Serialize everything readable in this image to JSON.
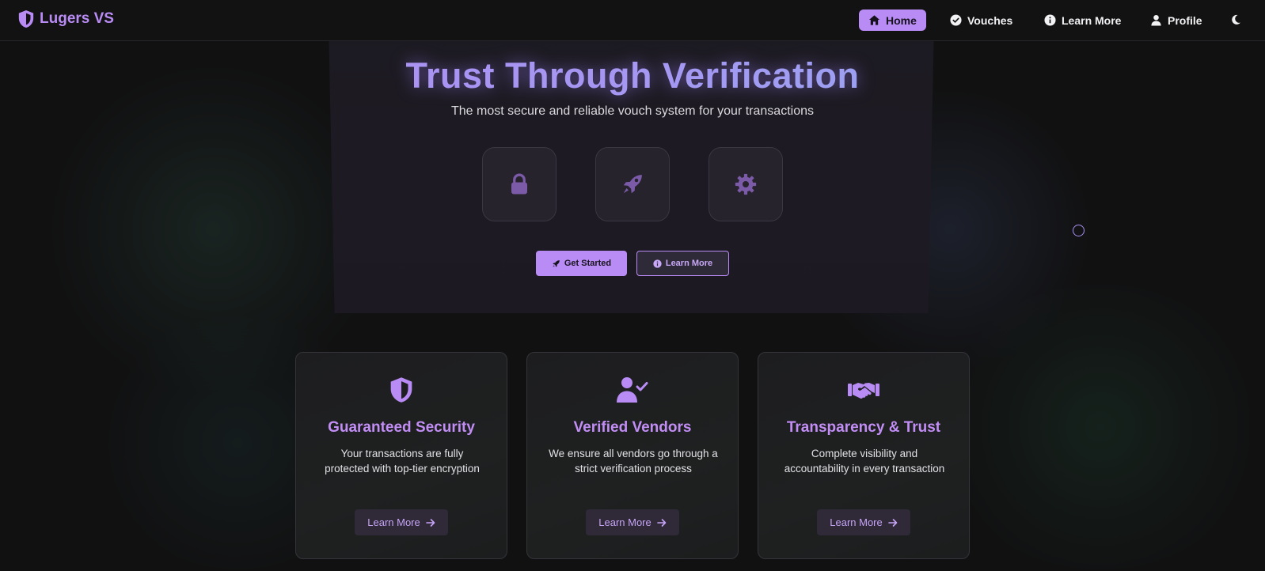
{
  "brand": {
    "name": "Lugers VS",
    "icon": "shield-icon",
    "accent": "#b98cf5"
  },
  "nav": {
    "items": [
      {
        "label": "Home",
        "icon": "home-icon",
        "active": true
      },
      {
        "label": "Vouches",
        "icon": "check-circle-icon"
      },
      {
        "label": "Learn More",
        "icon": "info-circle-icon"
      },
      {
        "label": "Profile",
        "icon": "user-icon"
      }
    ],
    "theme_toggle_icon": "moon-icon"
  },
  "hero": {
    "title": "Trust Through Verification",
    "subtitle": "The most secure and reliable vouch system for your transactions",
    "tiles": [
      "lock-icon",
      "rocket-icon",
      "gear-icon"
    ],
    "primary_button": {
      "label": "Get Started",
      "icon": "rocket-icon"
    },
    "secondary_button": {
      "label": "Learn More",
      "icon": "info-circle-icon"
    }
  },
  "features": [
    {
      "icon": "shield-half-icon",
      "title": "Guaranteed Security",
      "desc_line1": "Your transactions are fully",
      "desc_line2": "protected with top-tier encryption",
      "button": "Learn More"
    },
    {
      "icon": "user-check-icon",
      "title": "Verified Vendors",
      "desc_line1": "We ensure all vendors go through a",
      "desc_line2": "strict verification process",
      "button": "Learn More"
    },
    {
      "icon": "handshake-icon",
      "title": "Transparency & Trust",
      "desc_line1": "Complete visibility and",
      "desc_line2": "accountability in every transaction",
      "button": "Learn More"
    }
  ]
}
